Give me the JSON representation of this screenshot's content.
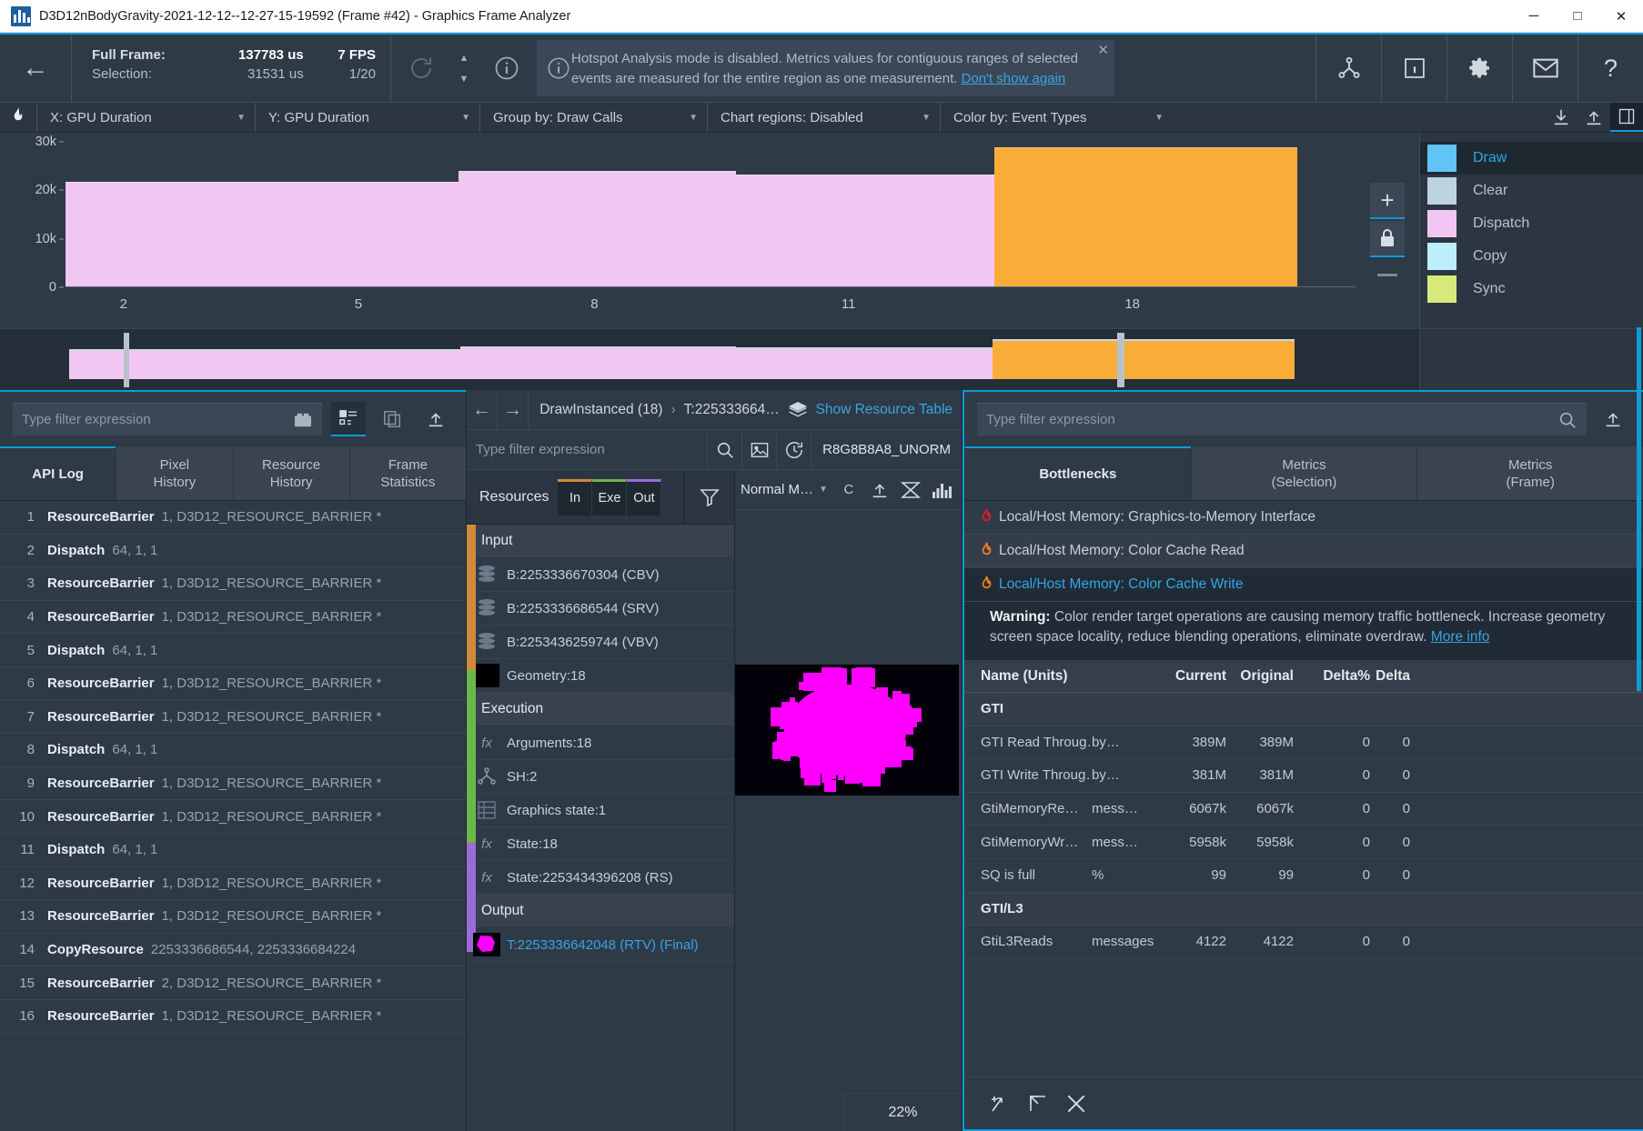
{
  "window": {
    "title": "D3D12nBodyGravity-2021-12-12--12-27-15-19592 (Frame #42) - Graphics Frame Analyzer",
    "minimize": "─",
    "maximize": "□",
    "close": "✕"
  },
  "toolbar": {
    "back_label": "←",
    "full_frame_label": "Full Frame:",
    "full_frame_value": "137783 us",
    "fps_value": "7 FPS",
    "selection_label": "Selection:",
    "selection_value": "31531 us",
    "selection_ratio": "1/20",
    "notification": {
      "text_part1": "Hotspot Analysis mode is disabled. Metrics values for contiguous ranges of selected events are measured for the entire region as one measurement. ",
      "link": "Don't show again",
      "close": "✕"
    }
  },
  "chartbar": {
    "x_axis": "X: GPU Duration",
    "y_axis": "Y: GPU Duration",
    "group_by": "Group by: Draw Calls",
    "chart_regions": "Chart regions: Disabled",
    "color_by": "Color by: Event Types",
    "caret": "▼"
  },
  "chart_data": {
    "type": "bar",
    "title": "",
    "xlabel": "",
    "ylabel": "",
    "ylim": [
      0,
      30000
    ],
    "ytick_labels": [
      "30k",
      "20k",
      "10k",
      "0"
    ],
    "ytick_values": [
      30000,
      20000,
      10000,
      0
    ],
    "xtick_labels": [
      "2",
      "5",
      "8",
      "11",
      "18"
    ],
    "xtick_positions": [
      0.045,
      0.227,
      0.41,
      0.607,
      0.827
    ],
    "grid": false,
    "legend_position": "right",
    "series": [
      {
        "name": "Dispatch",
        "color": "#f2c6f2",
        "segments": [
          {
            "x_start": 0.0,
            "x_end": 0.305,
            "value": 21500
          },
          {
            "x_start": 0.305,
            "x_end": 0.52,
            "value": 23800
          },
          {
            "x_start": 0.52,
            "x_end": 0.72,
            "value": 23000
          }
        ]
      },
      {
        "name": "Draw",
        "color": "#f9ad38",
        "segments": [
          {
            "x_start": 0.72,
            "x_end": 0.955,
            "value": 28600
          }
        ]
      }
    ]
  },
  "legend": {
    "selected": "Draw",
    "items": [
      {
        "label": "Draw",
        "color": "#62c3f7"
      },
      {
        "label": "Clear",
        "color": "#bdd3dd"
      },
      {
        "label": "Dispatch",
        "color": "#f2c6f2"
      },
      {
        "label": "Copy",
        "color": "#bdeefb"
      },
      {
        "label": "Sync",
        "color": "#d6e97a"
      }
    ]
  },
  "zoom_controls": {
    "plus": "+",
    "lock": "lock",
    "minus": "—"
  },
  "left_panel": {
    "filter_placeholder": "Type filter expression",
    "tabs": [
      {
        "label": "API Log",
        "line2": "",
        "active": true
      },
      {
        "label": "Pixel",
        "line2": "History",
        "active": false
      },
      {
        "label": "Resource",
        "line2": "History",
        "active": false
      },
      {
        "label": "Frame",
        "line2": "Statistics",
        "active": false
      }
    ],
    "rows": [
      {
        "n": "1",
        "fn": "ResourceBarrier",
        "args": "1,  D3D12_RESOURCE_BARRIER *"
      },
      {
        "n": "2",
        "fn": "Dispatch",
        "args": "64, 1, 1"
      },
      {
        "n": "3",
        "fn": "ResourceBarrier",
        "args": "1,  D3D12_RESOURCE_BARRIER *"
      },
      {
        "n": "4",
        "fn": "ResourceBarrier",
        "args": "1,  D3D12_RESOURCE_BARRIER *"
      },
      {
        "n": "5",
        "fn": "Dispatch",
        "args": "64, 1, 1"
      },
      {
        "n": "6",
        "fn": "ResourceBarrier",
        "args": "1,  D3D12_RESOURCE_BARRIER *"
      },
      {
        "n": "7",
        "fn": "ResourceBarrier",
        "args": "1,  D3D12_RESOURCE_BARRIER *"
      },
      {
        "n": "8",
        "fn": "Dispatch",
        "args": "64, 1, 1"
      },
      {
        "n": "9",
        "fn": "ResourceBarrier",
        "args": "1,  D3D12_RESOURCE_BARRIER *"
      },
      {
        "n": "10",
        "fn": "ResourceBarrier",
        "args": "1,  D3D12_RESOURCE_BARRIER *"
      },
      {
        "n": "11",
        "fn": "Dispatch",
        "args": "64, 1, 1"
      },
      {
        "n": "12",
        "fn": "ResourceBarrier",
        "args": "1,  D3D12_RESOURCE_BARRIER *"
      },
      {
        "n": "13",
        "fn": "ResourceBarrier",
        "args": "1,  D3D12_RESOURCE_BARRIER *"
      },
      {
        "n": "14",
        "fn": "CopyResource",
        "args": "2253336686544, 2253336684224"
      },
      {
        "n": "15",
        "fn": "ResourceBarrier",
        "args": "2,  D3D12_RESOURCE_BARRIER *"
      },
      {
        "n": "16",
        "fn": "ResourceBarrier",
        "args": "1,  D3D12_RESOURCE_BARRIER *"
      }
    ]
  },
  "mid_panel": {
    "breadcrumb": {
      "back": "←",
      "forward": "→",
      "item1": "DrawInstanced (18)",
      "sep": "›",
      "item2": "T:225333664…",
      "show_resource_table": "Show Resource Table"
    },
    "filter_placeholder": "Type filter expression",
    "format": "R8G8B8A8_UNORM",
    "resources": {
      "title": "Resources",
      "segments": [
        {
          "label": "In",
          "color": "#d08a3a"
        },
        {
          "label": "Exe",
          "color": "#6bb84a"
        },
        {
          "label": "Out",
          "color": "#9b6bd6"
        }
      ],
      "groups": [
        {
          "name": "Input",
          "items": [
            {
              "icon": "buffer-icon",
              "label": "B:2253336670304 (CBV)"
            },
            {
              "icon": "buffer-icon",
              "label": "B:2253336686544 (SRV)"
            },
            {
              "icon": "buffer-icon",
              "label": "B:2253436259744 (VBV)"
            },
            {
              "icon": "texture-icon",
              "label": "Geometry:18"
            }
          ]
        },
        {
          "name": "Execution",
          "items": [
            {
              "icon": "fx-icon",
              "label": "Arguments:18"
            },
            {
              "icon": "shader-icon",
              "label": "SH:2"
            },
            {
              "icon": "state-icon",
              "label": "Graphics state:1"
            },
            {
              "icon": "fx-icon",
              "label": "State:18"
            },
            {
              "icon": "fx-icon",
              "label": "State:2253434396208 (RS)"
            }
          ]
        },
        {
          "name": "Output",
          "items": [
            {
              "icon": "rtv-icon",
              "label": "T:2253336642048 (RTV) (Final)",
              "link": true
            }
          ]
        }
      ]
    },
    "view_mode": "Normal M…",
    "zoom_level": "22%"
  },
  "right_panel": {
    "filter_placeholder": "Type filter expression",
    "tabs": [
      {
        "label": "Bottlenecks",
        "line2": "",
        "active": true
      },
      {
        "label": "Metrics",
        "line2": "(Selection)",
        "active": false
      },
      {
        "label": "Metrics",
        "line2": "(Frame)",
        "active": false
      }
    ],
    "bottlenecks": [
      {
        "label": "Local/Host Memory: Graphics-to-Memory Interface",
        "flame": "#e01a2b",
        "selected": false
      },
      {
        "label": "Local/Host Memory: Color Cache Read",
        "flame": "#ef7d1e",
        "selected": false
      },
      {
        "label": "Local/Host Memory: Color Cache Write",
        "flame": "#ef7d1e",
        "selected": true
      }
    ],
    "warning": {
      "label": "Warning:",
      "text": " Color render target operations are causing memory traffic bottleneck. Increase geometry screen space locality, reduce blending operations, eliminate overdraw. ",
      "link": "More info"
    },
    "metrics_headers": [
      "Name (Units)",
      "",
      "Current",
      "Original",
      "Delta%",
      "Delta"
    ],
    "metrics": [
      {
        "group": "GTI"
      },
      {
        "name": "GTI Read Throug…",
        "unit": "by…",
        "current": "389M",
        "original": "389M",
        "deltap": "0",
        "delta": "0"
      },
      {
        "name": "GTI Write Throug…",
        "unit": "by…",
        "current": "381M",
        "original": "381M",
        "deltap": "0",
        "delta": "0"
      },
      {
        "name": "GtiMemoryRe…",
        "unit": "mess…",
        "current": "6067k",
        "original": "6067k",
        "deltap": "0",
        "delta": "0"
      },
      {
        "name": "GtiMemoryWr…",
        "unit": "mess…",
        "current": "5958k",
        "original": "5958k",
        "deltap": "0",
        "delta": "0"
      },
      {
        "name": "SQ is full",
        "unit": "%",
        "current": "99",
        "original": "99",
        "deltap": "0",
        "delta": "0"
      },
      {
        "group": "GTI/L3"
      },
      {
        "name": "GtiL3Reads",
        "unit": "messages",
        "current": "4122",
        "original": "4122",
        "deltap": "0",
        "delta": "0"
      }
    ]
  }
}
